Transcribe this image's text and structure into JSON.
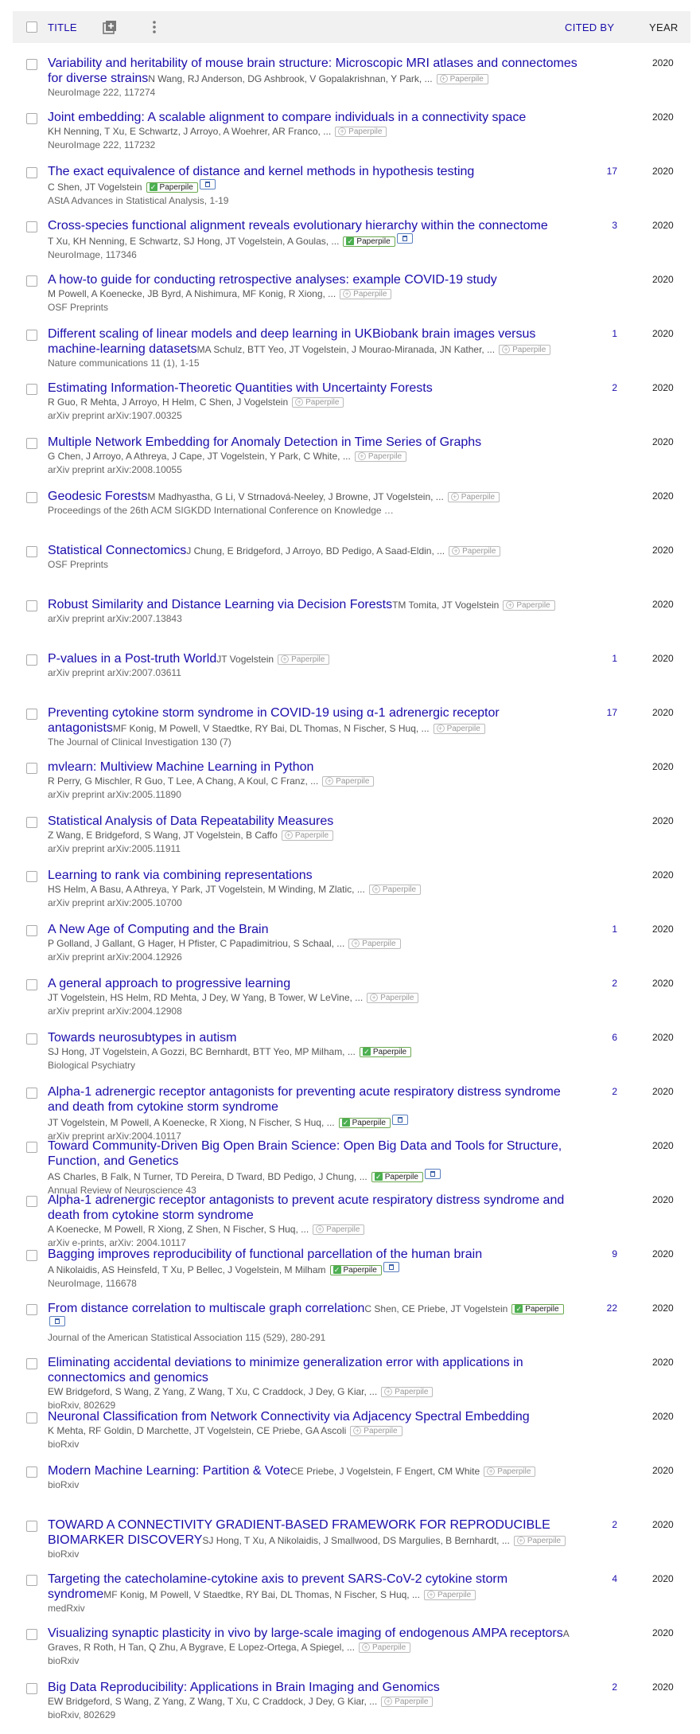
{
  "header": {
    "title_label": "TITLE",
    "cited_by_label": "CITED BY",
    "year_label": "YEAR"
  },
  "colors": {
    "link": "#1a0dab",
    "header_bg": "#f1f1f1",
    "paperpile_green": "#4caf50"
  },
  "paperpile_label": "Paperpile",
  "articles": [
    {
      "title": "Variability and heritability of mouse brain structure: Microscopic MRI atlases and connectomes for diverse strains",
      "authors": "N Wang, RJ Anderson, DG Ashbrook, V Gopalakrishnan, Y Park, ...",
      "venue": "NeuroImage 222, 117274",
      "cited": "",
      "year": "2020",
      "paperpile": "add",
      "doc": false,
      "inline": true
    },
    {
      "title": "Joint embedding: A scalable alignment to compare individuals in a connectivity space",
      "authors": "KH Nenning, T Xu, E Schwartz, J Arroyo, A Woehrer, AR Franco, ...",
      "venue": "NeuroImage 222, 117232",
      "cited": "",
      "year": "2020",
      "paperpile": "add",
      "doc": false,
      "inline": false
    },
    {
      "title": "The exact equivalence of distance and kernel methods in hypothesis testing",
      "authors": "C Shen, JT Vogelstein",
      "venue": "AStA Advances in Statistical Analysis, 1-19",
      "cited": "17",
      "year": "2020",
      "paperpile": "saved",
      "doc": true,
      "inline": false
    },
    {
      "title": "Cross-species functional alignment reveals evolutionary hierarchy within the connectome",
      "authors": "T Xu, KH Nenning, E Schwartz, SJ Hong, JT Vogelstein, A Goulas, ...",
      "venue": "NeuroImage, 117346",
      "cited": "3",
      "year": "2020",
      "paperpile": "saved",
      "doc": true,
      "inline": false
    },
    {
      "title": "A how-to guide for conducting retrospective analyses: example COVID-19 study",
      "authors": "M Powell, A Koenecke, JB Byrd, A Nishimura, MF Konig, R Xiong, ...",
      "venue": "OSF Preprints",
      "cited": "",
      "year": "2020",
      "paperpile": "add",
      "doc": false,
      "inline": false
    },
    {
      "title": "Different scaling of linear models and deep learning in UKBiobank brain images versus machine-learning datasets",
      "authors": "MA Schulz, BTT Yeo, JT Vogelstein, J Mourao-Miranada, JN Kather, ...",
      "venue": "Nature communications 11 (1), 1-15",
      "cited": "1",
      "year": "2020",
      "paperpile": "add",
      "doc": false,
      "inline": true
    },
    {
      "title": "Estimating Information-Theoretic Quantities with Uncertainty Forests",
      "authors": "R Guo, R Mehta, J Arroyo, H Helm, C Shen, J Vogelstein",
      "venue": "arXiv preprint arXiv:1907.00325",
      "cited": "2",
      "year": "2020",
      "paperpile": "add",
      "doc": false,
      "inline": false
    },
    {
      "title": "Multiple Network Embedding for Anomaly Detection in Time Series of Graphs",
      "authors": "G Chen, J Arroyo, A Athreya, J Cape, JT Vogelstein, Y Park, C White, ...",
      "venue": "arXiv preprint arXiv:2008.10055",
      "cited": "",
      "year": "2020",
      "paperpile": "add",
      "doc": false,
      "inline": false
    },
    {
      "title": "Geodesic Forests",
      "authors": "M Madhyastha, G Li, V Strnadová-Neeley, J Browne, JT Vogelstein, ...",
      "venue": "Proceedings of the 26th ACM SIGKDD International Conference on Knowledge …",
      "cited": "",
      "year": "2020",
      "paperpile": "add",
      "doc": false,
      "inline": true
    },
    {
      "title": "Statistical Connectomics",
      "authors": "J Chung, E Bridgeford, J Arroyo, BD Pedigo, A Saad-Eldin, ...",
      "venue": "OSF Preprints",
      "cited": "",
      "year": "2020",
      "paperpile": "add",
      "doc": false,
      "inline": true
    },
    {
      "title": "Robust Similarity and Distance Learning via Decision Forests",
      "authors": "TM Tomita, JT Vogelstein",
      "venue": "arXiv preprint arXiv:2007.13843",
      "cited": "",
      "year": "2020",
      "paperpile": "add",
      "doc": false,
      "inline": true
    },
    {
      "title": "P-values in a Post-truth World",
      "authors": "JT Vogelstein",
      "venue": "arXiv preprint arXiv:2007.03611",
      "cited": "1",
      "year": "2020",
      "paperpile": "add",
      "doc": false,
      "inline": true
    },
    {
      "title": "Preventing cytokine storm syndrome in COVID-19 using α-1 adrenergic receptor antagonists",
      "authors": "MF Konig, M Powell, V Staedtke, RY Bai, DL Thomas, N Fischer, S Huq, ...",
      "venue": "The Journal of Clinical Investigation 130 (7)",
      "cited": "17",
      "year": "2020",
      "paperpile": "add",
      "doc": false,
      "inline": true
    },
    {
      "title": "mvlearn: Multiview Machine Learning in Python",
      "authors": "R Perry, G Mischler, R Guo, T Lee, A Chang, A Koul, C Franz, ...",
      "venue": "arXiv preprint arXiv:2005.11890",
      "cited": "",
      "year": "2020",
      "paperpile": "add",
      "doc": false,
      "inline": false
    },
    {
      "title": "Statistical Analysis of Data Repeatability Measures",
      "authors": "Z Wang, E Bridgeford, S Wang, JT Vogelstein, B Caffo",
      "venue": "arXiv preprint arXiv:2005.11911",
      "cited": "",
      "year": "2020",
      "paperpile": "add",
      "doc": false,
      "inline": false
    },
    {
      "title": "Learning to rank via combining representations",
      "authors": "HS Helm, A Basu, A Athreya, Y Park, JT Vogelstein, M Winding, M Zlatic, ...",
      "venue": "arXiv preprint arXiv:2005.10700",
      "cited": "",
      "year": "2020",
      "paperpile": "add",
      "doc": false,
      "inline": false
    },
    {
      "title": "A New Age of Computing and the Brain",
      "authors": "P Golland, J Gallant, G Hager, H Pfister, C Papadimitriou, S Schaal, ...",
      "venue": "arXiv preprint arXiv:2004.12926",
      "cited": "1",
      "year": "2020",
      "paperpile": "add",
      "doc": false,
      "inline": false
    },
    {
      "title": "A general approach to progressive learning",
      "authors": "JT Vogelstein, HS Helm, RD Mehta, J Dey, W Yang, B Tower, W LeVine, ...",
      "venue": "arXiv preprint arXiv:2004.12908",
      "cited": "2",
      "year": "2020",
      "paperpile": "add",
      "doc": false,
      "inline": false
    },
    {
      "title": "Towards neurosubtypes in autism",
      "authors": "SJ Hong, JT Vogelstein, A Gozzi, BC Bernhardt, BTT Yeo, MP Milham, ...",
      "venue": "Biological Psychiatry",
      "cited": "6",
      "year": "2020",
      "paperpile": "saved",
      "doc": false,
      "inline": false
    },
    {
      "title": "Alpha-1 adrenergic receptor antagonists for preventing acute respiratory distress syndrome and death from cytokine storm syndrome",
      "authors": "JT Vogelstein, M Powell, A Koenecke, R Xiong, N Fischer, S Huq, ...",
      "venue": "arXiv preprint arXiv:2004.10117",
      "cited": "2",
      "year": "2020",
      "paperpile": "saved",
      "doc": true,
      "inline": false
    },
    {
      "title": "Toward Community-Driven Big Open Brain Science: Open Big Data and Tools for Structure, Function, and Genetics",
      "authors": "AS Charles, B Falk, N Turner, TD Pereira, D Tward, BD Pedigo, J Chung, ...",
      "venue": "Annual Review of Neuroscience 43",
      "cited": "",
      "year": "2020",
      "paperpile": "saved",
      "doc": true,
      "inline": false
    },
    {
      "title": "Alpha-1 adrenergic receptor antagonists to prevent acute respiratory distress syndrome and death from cytokine storm syndrome",
      "authors": "A Koenecke, M Powell, R Xiong, Z Shen, N Fischer, S Huq, ...",
      "venue": "arXiv e-prints, arXiv: 2004.10117",
      "cited": "",
      "year": "2020",
      "paperpile": "add",
      "doc": false,
      "inline": false
    },
    {
      "title": "Bagging improves reproducibility of functional parcellation of the human brain",
      "authors": "A Nikolaidis, AS Heinsfeld, T Xu, P Bellec, J Vogelstein, M Milham",
      "venue": "NeuroImage, 116678",
      "cited": "9",
      "year": "2020",
      "paperpile": "saved",
      "doc": true,
      "inline": false
    },
    {
      "title": "From distance correlation to multiscale graph correlation",
      "authors": "C Shen, CE Priebe, JT Vogelstein",
      "venue": "Journal of the American Statistical Association 115 (529), 280-291",
      "cited": "22",
      "year": "2020",
      "paperpile": "saved",
      "doc": true,
      "inline": true
    },
    {
      "title": "Eliminating accidental deviations to minimize generalization error with applications in connectomics and genomics",
      "authors": "EW Bridgeford, S Wang, Z Yang, Z Wang, T Xu, C Craddock, J Dey, G Kiar, ...",
      "venue": "bioRxiv, 802629",
      "cited": "",
      "year": "2020",
      "paperpile": "add",
      "doc": false,
      "inline": false
    },
    {
      "title": "Neuronal Classification from Network Connectivity via Adjacency Spectral Embedding",
      "authors": "K Mehta, RF Goldin, D Marchette, JT Vogelstein, CE Priebe, GA Ascoli",
      "venue": "bioRxiv",
      "cited": "",
      "year": "2020",
      "paperpile": "add",
      "doc": false,
      "inline": false
    },
    {
      "title": "Modern Machine Learning: Partition & Vote",
      "authors": "CE Priebe, J Vogelstein, F Engert, CM White",
      "venue": "bioRxiv",
      "cited": "",
      "year": "2020",
      "paperpile": "add",
      "doc": false,
      "inline": true
    },
    {
      "title": "TOWARD A CONNECTIVITY GRADIENT-BASED FRAMEWORK FOR REPRODUCIBLE BIOMARKER DISCOVERY",
      "authors": "SJ Hong, T Xu, A Nikolaidis, J Smallwood, DS Margulies, B Bernhardt, ...",
      "venue": "bioRxiv",
      "cited": "2",
      "year": "2020",
      "paperpile": "add",
      "doc": false,
      "inline": true
    },
    {
      "title": "Targeting the catecholamine-cytokine axis to prevent SARS-CoV-2 cytokine storm syndrome",
      "authors": "MF Konig, M Powell, V Staedtke, RY Bai, DL Thomas, N Fischer, S Huq, ...",
      "venue": "medRxiv",
      "cited": "4",
      "year": "2020",
      "paperpile": "add",
      "doc": false,
      "inline": true
    },
    {
      "title": "Visualizing synaptic plasticity in vivo by large-scale imaging of endogenous AMPA receptors",
      "authors": "A Graves, R Roth, H Tan, Q Zhu, A Bygrave, E Lopez-Ortega, A Spiegel, ...",
      "venue": "bioRxiv",
      "cited": "",
      "year": "2020",
      "paperpile": "add",
      "doc": false,
      "inline": true
    },
    {
      "title": "Big Data Reproducibility: Applications in Brain Imaging and Genomics",
      "authors": "EW Bridgeford, S Wang, Z Yang, Z Wang, T Xu, C Craddock, J Dey, G Kiar, ...",
      "venue": "bioRxiv, 802629",
      "cited": "2",
      "year": "2020",
      "paperpile": "add",
      "doc": false,
      "inline": false
    }
  ]
}
